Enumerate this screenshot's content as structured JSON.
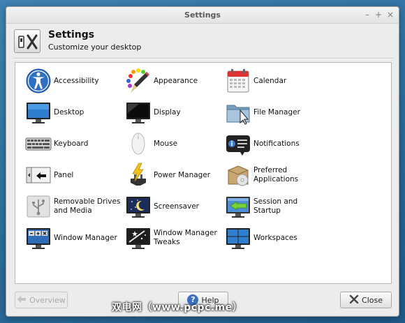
{
  "window": {
    "title": "Settings"
  },
  "header": {
    "title": "Settings",
    "subtitle": "Customize your desktop"
  },
  "items": [
    {
      "label": "Accessibility",
      "icon": "accessibility-icon"
    },
    {
      "label": "Appearance",
      "icon": "appearance-icon"
    },
    {
      "label": "Calendar",
      "icon": "calendar-icon"
    },
    {
      "label": "Desktop",
      "icon": "desktop-icon"
    },
    {
      "label": "Display",
      "icon": "display-icon"
    },
    {
      "label": "File Manager",
      "icon": "file-manager-icon"
    },
    {
      "label": "Keyboard",
      "icon": "keyboard-icon"
    },
    {
      "label": "Mouse",
      "icon": "mouse-icon"
    },
    {
      "label": "Notifications",
      "icon": "notifications-icon"
    },
    {
      "label": "Panel",
      "icon": "panel-icon"
    },
    {
      "label": "Power Manager",
      "icon": "power-manager-icon"
    },
    {
      "label": "Preferred Applications",
      "icon": "preferred-applications-icon"
    },
    {
      "label": "Removable Drives and Media",
      "icon": "removable-drives-icon"
    },
    {
      "label": "Screensaver",
      "icon": "screensaver-icon"
    },
    {
      "label": "Session and Startup",
      "icon": "session-startup-icon"
    },
    {
      "label": "Window Manager",
      "icon": "window-manager-icon"
    },
    {
      "label": "Window Manager Tweaks",
      "icon": "window-manager-tweaks-icon"
    },
    {
      "label": "Workspaces",
      "icon": "workspaces-icon"
    }
  ],
  "footer": {
    "overview_label": "Overview",
    "help_label": "Help",
    "close_label": "Close"
  },
  "watermark": "双电网（www.pcpc.me）"
}
